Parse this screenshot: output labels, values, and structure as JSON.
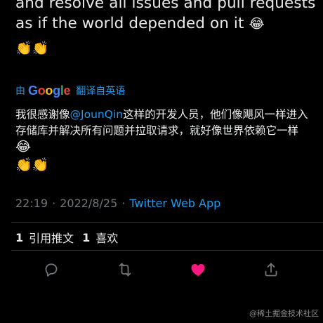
{
  "tweet": {
    "text_line1": "and resolve all issues and pull requests",
    "text_line2": "as if the world depended on it",
    "text_emoji": "😂",
    "clap_emojis": "👏👏"
  },
  "translation": {
    "by_label": "由",
    "google_G": "G",
    "google_o1": "o",
    "google_o2": "o",
    "google_g": "g",
    "google_l": "l",
    "google_e": "e",
    "link_label": "翻译自英语",
    "line_prefix": "我很感谢像",
    "mention": "@JounQin",
    "line_rest": "这样的开发人员，他们像飓风一样进入存储库并解决所有问题并拉取请求，就好像世界依赖它一样",
    "line_emoji": "😂",
    "clap_emojis": "👏👏"
  },
  "meta": {
    "time": "22:19",
    "sep1": "·",
    "date": "2022/8/25",
    "sep2": "·",
    "app": "Twitter Web App"
  },
  "stats": {
    "retweets_count": "1",
    "retweets_label": "引用推文",
    "likes_count": "1",
    "likes_label": "喜欢"
  },
  "actions": {
    "reply_icon": "reply-icon",
    "retweet_icon": "retweet-icon",
    "like_icon": "heart-icon",
    "share_icon": "share-icon",
    "like_color": "#f91880",
    "icon_color": "#71767b"
  },
  "watermark": "@稀土掘金技术社区"
}
